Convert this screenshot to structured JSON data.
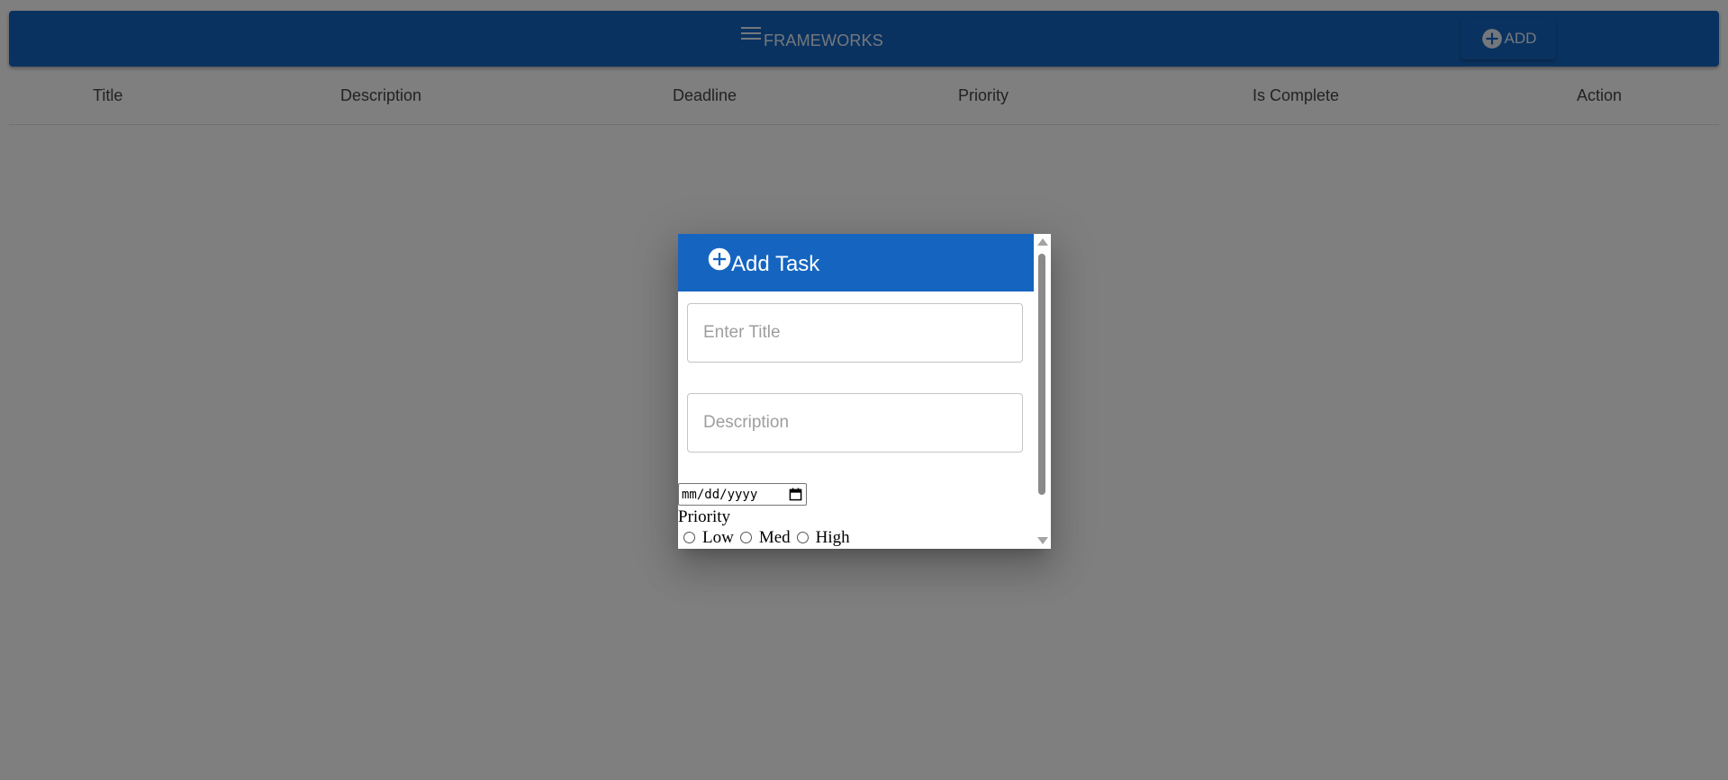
{
  "appbar": {
    "title": "FRAMEWORKS",
    "menu_icon": "menu-icon",
    "add_label": "ADD",
    "add_icon": "add-circle-icon",
    "color": "#1565c0"
  },
  "table": {
    "headers": [
      "Title",
      "Description",
      "Deadline",
      "Priority",
      "Is Complete",
      "Action"
    ]
  },
  "dialog": {
    "title": "Add Task",
    "title_icon": "add-circle-icon",
    "title_placeholder": "Enter Title",
    "description_placeholder": "Description",
    "deadline_placeholder": "mm/dd/yyyy",
    "priority_label": "Priority",
    "priority_options": [
      "Low",
      "Med",
      "High"
    ]
  }
}
